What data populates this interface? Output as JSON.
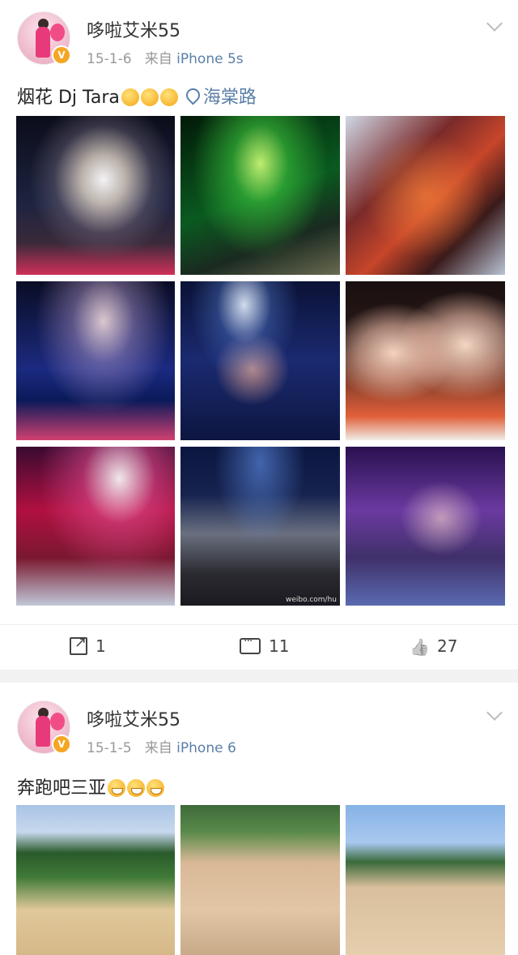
{
  "posts": [
    {
      "user": {
        "name": "哆啦艾米55",
        "verified": "V"
      },
      "date": "15-1-6",
      "source_prefix": "来自",
      "source": "iPhone 5s",
      "text": "烟花 Dj Tara",
      "location": "海棠路",
      "images": [
        {
          "desc": "fireworks over stage"
        },
        {
          "desc": "green laser stage"
        },
        {
          "desc": "large birthday cake with candles"
        },
        {
          "desc": "blue fireworks stage"
        },
        {
          "desc": "two people by dj booth"
        },
        {
          "desc": "two women selfie"
        },
        {
          "desc": "red stage performance"
        },
        {
          "desc": "group photo crowd"
        },
        {
          "desc": "people under purple lights"
        }
      ],
      "watermark": "weibo.com/hu",
      "actions": {
        "repost": "1",
        "comment": "11",
        "like": "27"
      }
    },
    {
      "user": {
        "name": "哆啦艾米55",
        "verified": "V"
      },
      "date": "15-1-5",
      "source_prefix": "来自",
      "source": "iPhone 6",
      "text": "奔跑吧三亚",
      "images": [
        {
          "desc": "group on beach"
        },
        {
          "desc": "people playing in sand"
        },
        {
          "desc": "beach game with sky"
        }
      ]
    }
  ],
  "colors": {
    "link": "#5b7fa8",
    "meta": "#999999",
    "verified": "#f5a623"
  },
  "icons": [
    "chevron-down-icon",
    "location-pin-icon",
    "repost-icon",
    "comment-icon",
    "like-icon",
    "emoji-icon"
  ]
}
